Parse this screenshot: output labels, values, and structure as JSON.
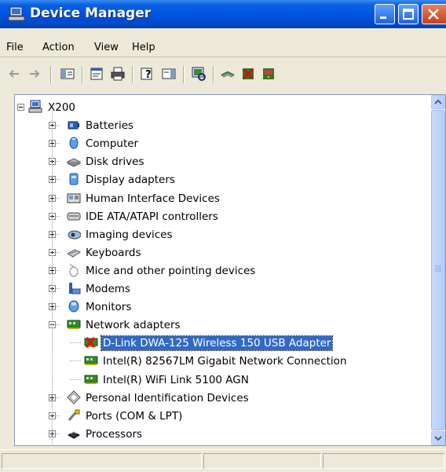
{
  "window": {
    "title": "Device Manager"
  },
  "menu": {
    "items": [
      "File",
      "Action",
      "View",
      "Help"
    ]
  },
  "toolbar": {
    "buttons": [
      "back-icon",
      "forward-icon",
      "show-hide-console-tree-icon",
      "properties-icon",
      "print-icon",
      "help-icon",
      "show-hide-action-pane-icon",
      "scan-for-hardware-changes-icon",
      "uninstall-icon",
      "disable-icon",
      "update-driver-icon"
    ]
  },
  "tree": {
    "root": "X200",
    "nodes": [
      {
        "label": "Batteries",
        "icon": "battery-icon",
        "expanded": false
      },
      {
        "label": "Computer",
        "icon": "computer-icon",
        "expanded": false
      },
      {
        "label": "Disk drives",
        "icon": "disk-drive-icon",
        "expanded": false
      },
      {
        "label": "Display adapters",
        "icon": "display-adapter-icon",
        "expanded": false
      },
      {
        "label": "Human Interface Devices",
        "icon": "hid-icon",
        "expanded": false
      },
      {
        "label": "IDE ATA/ATAPI controllers",
        "icon": "ide-controller-icon",
        "expanded": false
      },
      {
        "label": "Imaging devices",
        "icon": "imaging-device-icon",
        "expanded": false
      },
      {
        "label": "Keyboards",
        "icon": "keyboard-icon",
        "expanded": false
      },
      {
        "label": "Mice and other pointing devices",
        "icon": "mouse-icon",
        "expanded": false
      },
      {
        "label": "Modems",
        "icon": "modem-icon",
        "expanded": false
      },
      {
        "label": "Monitors",
        "icon": "monitor-icon",
        "expanded": false
      },
      {
        "label": "Network adapters",
        "icon": "network-adapter-icon",
        "expanded": true,
        "children": [
          {
            "label": "D-Link DWA-125 Wireless 150 USB Adapter",
            "icon": "network-adapter-error-icon",
            "selected": true
          },
          {
            "label": "Intel(R) 82567LM Gigabit Network Connection",
            "icon": "network-adapter-icon"
          },
          {
            "label": "Intel(R) WiFi Link 5100 AGN",
            "icon": "network-adapter-icon"
          }
        ]
      },
      {
        "label": "Personal Identification Devices",
        "icon": "identification-device-icon",
        "expanded": false
      },
      {
        "label": "Ports (COM & LPT)",
        "icon": "port-icon",
        "expanded": false
      },
      {
        "label": "Processors",
        "icon": "processor-icon",
        "expanded": false
      }
    ]
  },
  "colors": {
    "titlebar": "#0054e3",
    "selection": "#316ac5",
    "window_bg": "#ece9d8"
  }
}
